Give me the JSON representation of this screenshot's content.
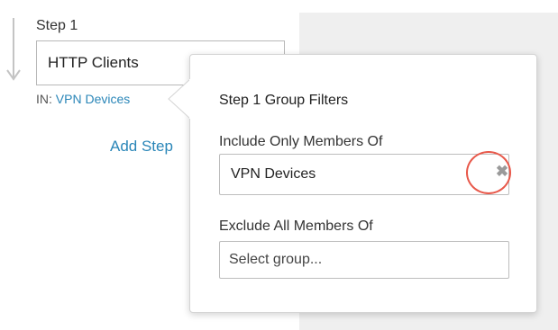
{
  "step": {
    "label": "Step 1",
    "input_value": "HTTP Clients",
    "in_prefix": "IN:",
    "in_group": "VPN Devices"
  },
  "add_step_label": "Add Step",
  "popover": {
    "title": "Step 1 Group Filters",
    "include": {
      "label": "Include Only Members Of",
      "value": "VPN Devices",
      "clear_icon": "close-icon"
    },
    "exclude": {
      "label": "Exclude All Members Of",
      "placeholder": "Select group..."
    }
  },
  "colors": {
    "link": "#2a86b8",
    "highlight": "#e8584a",
    "panel_bg": "#efefef"
  }
}
